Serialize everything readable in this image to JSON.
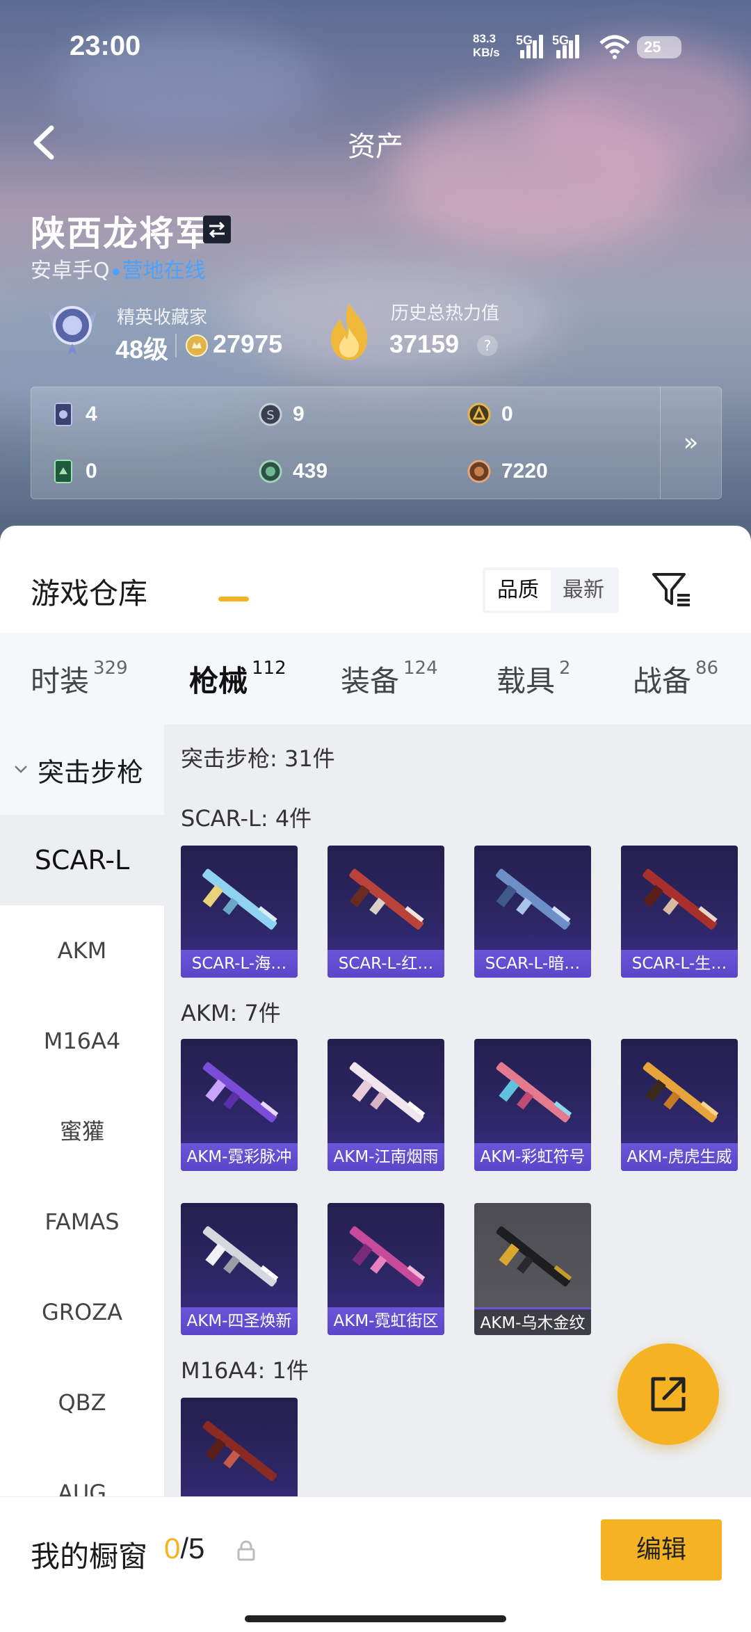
{
  "status_bar": {
    "time": "23:00",
    "net_speed_top": "83.3",
    "net_speed_unit": "KB/s",
    "sig1": "5G",
    "sig2": "5G",
    "battery": "25"
  },
  "header": {
    "title": "资产"
  },
  "profile": {
    "name": "陕西龙将军",
    "platform": "安卓手Q",
    "online_status": "营地在线",
    "collector_label": "精英收藏家",
    "level": "48级",
    "coins": "27975",
    "heat_label": "历史总热力值",
    "heat_value": "37159",
    "help": "?"
  },
  "resources": [
    {
      "icon": "card-icon",
      "value": "4"
    },
    {
      "icon": "silver-coin-icon",
      "value": "9"
    },
    {
      "icon": "gold-emblem-icon",
      "value": "0"
    },
    {
      "icon": "green-card-icon",
      "value": "0"
    },
    {
      "icon": "green-coin-icon",
      "value": "439"
    },
    {
      "icon": "bronze-coin-icon",
      "value": "7220"
    }
  ],
  "resources_more": "»",
  "warehouse": {
    "title": "游戏仓库",
    "sort_options": [
      "品质",
      "最新"
    ],
    "tabs": [
      {
        "label": "时装",
        "count": "329"
      },
      {
        "label": "枪械",
        "count": "112"
      },
      {
        "label": "装备",
        "count": "124"
      },
      {
        "label": "载具",
        "count": "2"
      },
      {
        "label": "战备",
        "count": "86"
      }
    ]
  },
  "sidebar": {
    "category": "突击步枪",
    "items": [
      "SCAR-L",
      "AKM",
      "M16A4",
      "蜜獾",
      "FAMAS",
      "GROZA",
      "QBZ",
      "AUG"
    ]
  },
  "content": {
    "summary": "突击步枪: 31件",
    "groups": [
      {
        "label": "SCAR-L: 4件",
        "items": [
          "SCAR-L-海…",
          "SCAR-L-红…",
          "SCAR-L-暗…",
          "SCAR-L-生…"
        ]
      },
      {
        "label": "AKM: 7件",
        "items": [
          "AKM-霓彩脉冲",
          "AKM-江南烟雨",
          "AKM-彩虹符号",
          "AKM-虎虎生威",
          "AKM-四圣焕新",
          "AKM-霓虹街区",
          "AKM-乌木金纹"
        ]
      },
      {
        "label": "M16A4: 1件",
        "items": [
          ""
        ]
      }
    ]
  },
  "showcase": {
    "label": "我的橱窗",
    "current": "0",
    "total": "/5",
    "edit": "编辑"
  },
  "colors": {
    "accent": "#f5b324",
    "link": "#4aa3ff",
    "card_caption": "#5a46c8"
  }
}
